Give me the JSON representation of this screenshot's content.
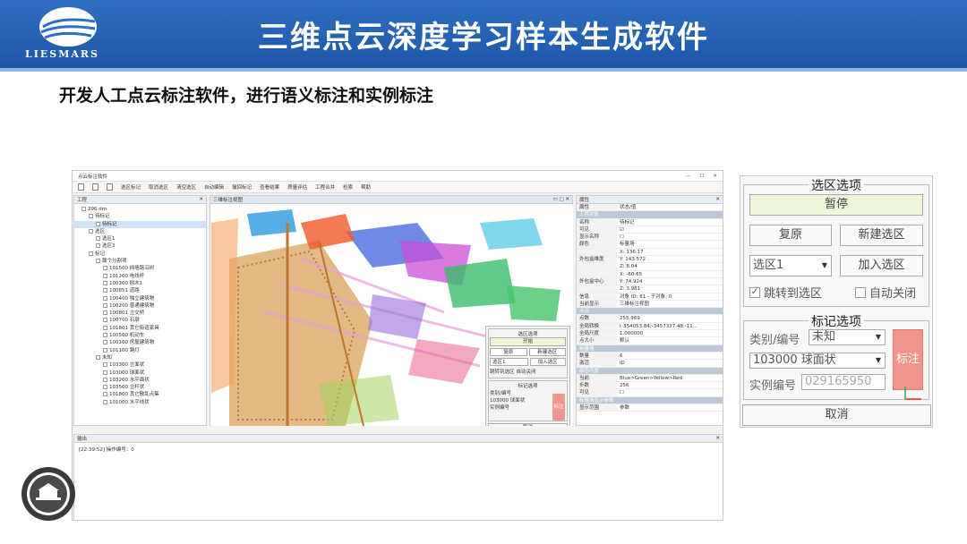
{
  "header": {
    "title": "三维点云深度学习样本生成软件",
    "logo_text": "LIESMARS"
  },
  "subtitle": "开发人工点云标注软件，进行语义标注和实例标注",
  "app": {
    "window_title": "点云标注软件",
    "toolbar": [
      "选区标记",
      "取消选区",
      "清空选区",
      "自动编辑",
      "撤回标记",
      "查看结果",
      "质量评估",
      "工程合并",
      "检索",
      "帮助"
    ],
    "project_panel": {
      "title": "工程",
      "items": [
        {
          "label": "296.dm",
          "indent": 1,
          "selected": false
        },
        {
          "label": "待标记",
          "indent": 2,
          "selected": false
        },
        {
          "label": "待标记",
          "indent": 3,
          "selected": true
        },
        {
          "label": "选区",
          "indent": 2,
          "selected": false
        },
        {
          "label": "选区1",
          "indent": 3,
          "selected": false
        },
        {
          "label": "选区2",
          "indent": 3,
          "selected": false
        },
        {
          "label": "标记",
          "indent": 2,
          "selected": false
        },
        {
          "label": "属个分割项",
          "indent": 3,
          "selected": false
        },
        {
          "label": "101500 挡墙路沿树",
          "indent": 4,
          "selected": false
        },
        {
          "label": "101200 电线杆",
          "indent": 4,
          "selected": false
        },
        {
          "label": "100300 树木1",
          "indent": 4,
          "selected": false
        },
        {
          "label": "100851 道路",
          "indent": 4,
          "selected": false
        },
        {
          "label": "100400 独立建筑物",
          "indent": 4,
          "selected": false
        },
        {
          "label": "100200 普通建筑物",
          "indent": 4,
          "selected": false
        },
        {
          "label": "100801 立交桥",
          "indent": 4,
          "selected": false
        },
        {
          "label": "100700 石墩",
          "indent": 4,
          "selected": false
        },
        {
          "label": "101801 其它街道家具",
          "indent": 4,
          "selected": false
        },
        {
          "label": "100500 机动车",
          "indent": 4,
          "selected": false
        },
        {
          "label": "100100 房屋建筑物",
          "indent": 4,
          "selected": false
        },
        {
          "label": "101100 路灯",
          "indent": 4,
          "selected": false
        },
        {
          "label": "未知",
          "indent": 3,
          "selected": false
        },
        {
          "label": "103300 立面状",
          "indent": 4,
          "selected": false
        },
        {
          "label": "103000 球面状",
          "indent": 4,
          "selected": false
        },
        {
          "label": "103200 水平面状",
          "indent": 4,
          "selected": false
        },
        {
          "label": "103500 立杆状",
          "indent": 4,
          "selected": false
        },
        {
          "label": "101800 其它散乱点集",
          "indent": 4,
          "selected": false
        },
        {
          "label": "101000 水平线状",
          "indent": 4,
          "selected": false
        }
      ]
    },
    "view_tab": "三维标注视图",
    "properties": {
      "title": "属性",
      "header": [
        "属性",
        "状态/值"
      ],
      "rows": [
        {
          "k": "工程对象",
          "v": "",
          "sec": true
        },
        {
          "k": "名称",
          "v": "待标记",
          "sec": false
        },
        {
          "k": "可见",
          "v": "☑",
          "sec": false
        },
        {
          "k": "显示名称",
          "v": "☐",
          "sec": false
        },
        {
          "k": "颜色",
          "v": "标量场",
          "sec": false
        },
        {
          "k": "",
          "v": "X: 136.17",
          "sec": false
        },
        {
          "k": "外包盒维度",
          "v": "Y: 143.572",
          "sec": false
        },
        {
          "k": "",
          "v": "Z: 8.04",
          "sec": false
        },
        {
          "k": "",
          "v": "X: -60.65",
          "sec": false
        },
        {
          "k": "外包盒中心",
          "v": "Y: 74.924",
          "sec": false
        },
        {
          "k": "",
          "v": "Z: 3.981",
          "sec": false
        },
        {
          "k": "信息",
          "v": "对象 ID: 81 - 子对象: 0",
          "sec": false
        },
        {
          "k": "当前显示",
          "v": "三维标注视图",
          "sec": false
        },
        {
          "k": "点云",
          "v": "",
          "sec": true
        },
        {
          "k": "点数",
          "v": "255,969",
          "sec": false
        },
        {
          "k": "全局转换",
          "v": "(-354053.84;-3457337.48;-11...",
          "sec": false
        },
        {
          "k": "全局尺度",
          "v": "1.000000",
          "sec": false
        },
        {
          "k": "点大小",
          "v": "默认",
          "sec": false
        },
        {
          "k": "标量场",
          "v": "",
          "sec": true
        },
        {
          "k": "数量",
          "v": "6",
          "sec": false
        },
        {
          "k": "激活",
          "v": "ID",
          "sec": false
        },
        {
          "k": "颜色尺度",
          "v": "",
          "sec": true
        },
        {
          "k": "当前",
          "v": "Blue>Green>Yellow>Red",
          "sec": false
        },
        {
          "k": "步数",
          "v": "256",
          "sec": false
        },
        {
          "k": "可见",
          "v": "☐",
          "sec": false
        },
        {
          "k": "标量场显示参数",
          "v": "",
          "sec": true
        }
      ],
      "tabs": [
        "显示范围",
        "参数"
      ]
    },
    "output": {
      "title": "输出",
      "log": "[22:39:52] 操作编号：0"
    },
    "mini_dialog": {
      "region_title": "选区选项",
      "pause": "开始",
      "restore": "复原",
      "new_region": "新建选区",
      "region": "选区1",
      "add_region": "加入选区",
      "jump": "跳转到选区",
      "auto_close": "自动关闭",
      "mark_title": "标记选项",
      "category_label": "类别/编号",
      "category": "未知",
      "code": "103000 球面状",
      "instance_label": "实例编号",
      "mark": "标注",
      "cancel": "取消"
    }
  },
  "dialog": {
    "region_group_title": "选区选项",
    "pause_button": "暂停",
    "restore_button": "复原",
    "new_region_button": "新建选区",
    "region_select": "选区1",
    "add_region_button": "加入选区",
    "jump_checkbox": "跳转到选区",
    "jump_checked": true,
    "auto_close_checkbox": "自动关闭",
    "auto_close_checked": false,
    "mark_group_title": "标记选项",
    "category_label": "类别/编号",
    "category_select": "未知",
    "code_select": "103000 球面状",
    "instance_label": "实例编号",
    "instance_placeholder": "029165950",
    "mark_button": "标注",
    "cancel_button": "取消"
  },
  "colors": {
    "header_blue": "#1d56a8",
    "mark_button": "#f1948a",
    "pause_button": "#eef6d9"
  }
}
